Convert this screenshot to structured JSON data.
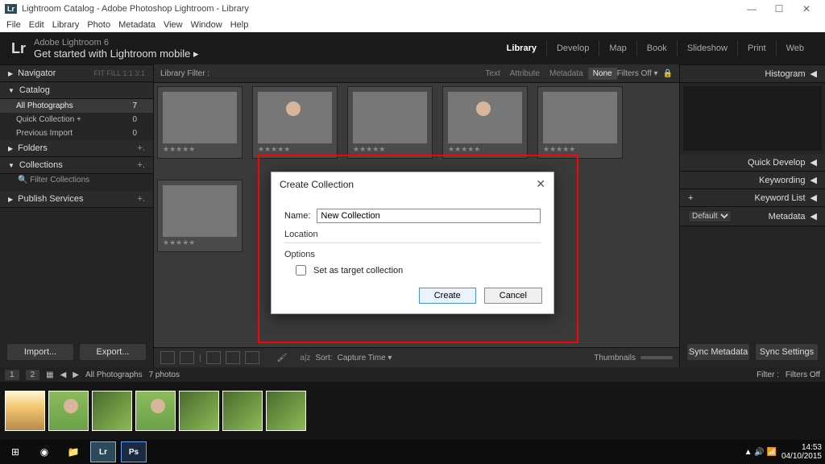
{
  "window": {
    "title": "Lightroom Catalog - Adobe Photoshop Lightroom - Library",
    "minimize": "—",
    "maximize": "☐",
    "close": "✕"
  },
  "menubar": [
    "File",
    "Edit",
    "Library",
    "Photo",
    "Metadata",
    "View",
    "Window",
    "Help"
  ],
  "brand": {
    "logo": "Lr",
    "line1": "Adobe Lightroom 6",
    "line2": "Get started with Lightroom mobile  ▸"
  },
  "modules": [
    "Library",
    "Develop",
    "Map",
    "Book",
    "Slideshow",
    "Print",
    "Web"
  ],
  "active_module": "Library",
  "left": {
    "navigator": "Navigator",
    "nav_meta": "FIT  FILL  1:1  3:1",
    "catalog": "Catalog",
    "catalog_items": [
      {
        "label": "All Photographs",
        "count": "7",
        "sel": true
      },
      {
        "label": "Quick Collection  +",
        "count": "0"
      },
      {
        "label": "Previous Import",
        "count": "0"
      }
    ],
    "folders": "Folders",
    "collections": "Collections",
    "filter_coll": "Filter Collections",
    "publish": "Publish Services",
    "import": "Import...",
    "export": "Export..."
  },
  "libfilter": {
    "label": "Library Filter :",
    "chips": [
      "Text",
      "Attribute",
      "Metadata",
      "None"
    ],
    "filters_off": "Filters Off ▾",
    "lock": "🔒"
  },
  "grid": {
    "star": "★★★★★",
    "count": 7
  },
  "toolbar": {
    "sort_label": "Sort:",
    "sort_value": "Capture Time ▾",
    "thumbnails": "Thumbnails"
  },
  "right": {
    "histogram": "Histogram",
    "quick_develop": "Quick Develop",
    "keywording": "Keywording",
    "keyword_list": "Keyword List",
    "metadata": "Metadata",
    "meta_preset": "Default",
    "sync_meta": "Sync Metadata",
    "sync_set": "Sync Settings"
  },
  "filmstrip": {
    "pages": [
      "1",
      "2"
    ],
    "breadcrumb": "All Photographs",
    "count_label": "7 photos",
    "filter_label": "Filter :",
    "filter_value": "Filters Off"
  },
  "dialog": {
    "title": "Create Collection",
    "name_label": "Name:",
    "name_value": "New Collection",
    "location": "Location",
    "options": "Options",
    "target_chk": "Set as target collection",
    "create": "Create",
    "cancel": "Cancel"
  },
  "tray": {
    "time": "14:53",
    "date": "04/10/2015"
  }
}
